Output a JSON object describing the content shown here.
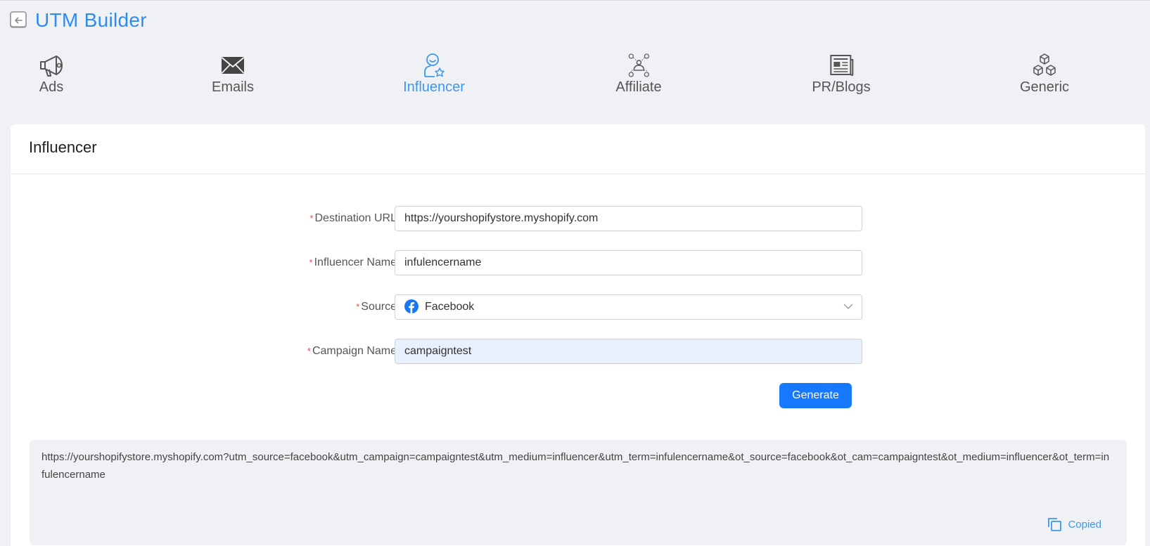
{
  "header": {
    "title": "UTM Builder"
  },
  "tabs": [
    {
      "label": "Ads",
      "icon": "megaphone-icon",
      "active": false
    },
    {
      "label": "Emails",
      "icon": "envelope-icon",
      "active": false
    },
    {
      "label": "Influencer",
      "icon": "influencer-icon",
      "active": true
    },
    {
      "label": "Affiliate",
      "icon": "affiliate-network-icon",
      "active": false
    },
    {
      "label": "PR/Blogs",
      "icon": "newspaper-icon",
      "active": false
    },
    {
      "label": "Generic",
      "icon": "cubes-icon",
      "active": false
    }
  ],
  "card": {
    "title": "Influencer"
  },
  "form": {
    "destination_url": {
      "label": "Destination URL",
      "value": "https://yourshopifystore.myshopify.com"
    },
    "influencer_name": {
      "label": "Influencer Name",
      "value": "infulencername"
    },
    "source": {
      "label": "Source",
      "value": "Facebook",
      "icon": "facebook-icon"
    },
    "campaign_name": {
      "label": "Campaign Name",
      "value": "campaigntest"
    },
    "required_marker": "*",
    "generate_label": "Generate"
  },
  "result": {
    "url": "https://yourshopifystore.myshopify.com?utm_source=facebook&utm_campaign=campaigntest&utm_medium=influencer&utm_term=infulencername&ot_source=facebook&ot_cam=campaigntest&ot_medium=influencer&ot_term=infulencername",
    "copy_label": "Copied"
  },
  "colors": {
    "accent": "#2f8cf0",
    "button": "#1677ff",
    "required": "#e5484d",
    "background": "#f0f1f5"
  }
}
